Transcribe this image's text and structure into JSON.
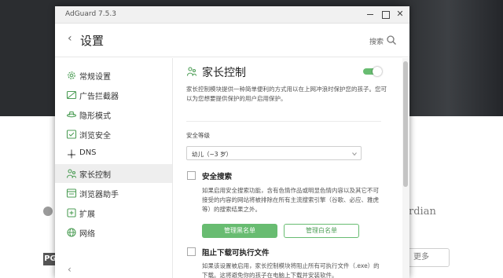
{
  "background": {
    "pg_text": "PG",
    "brand_text": "rdian",
    "more_button": "更多"
  },
  "window": {
    "title": "AdGuard 7.5.3"
  },
  "header": {
    "title": "设置",
    "search_label": "搜索"
  },
  "sidebar": {
    "items": [
      {
        "label": "常规设置",
        "icon": "gear-icon"
      },
      {
        "label": "广告拦截器",
        "icon": "ad-block-icon"
      },
      {
        "label": "隐形模式",
        "icon": "stealth-icon"
      },
      {
        "label": "浏览安全",
        "icon": "browsing-security-icon"
      },
      {
        "label": "DNS",
        "icon": "dns-icon"
      },
      {
        "label": "家长控制",
        "icon": "parental-control-icon"
      },
      {
        "label": "浏览器助手",
        "icon": "browser-assistant-icon"
      },
      {
        "label": "扩展",
        "icon": "extensions-icon"
      },
      {
        "label": "网络",
        "icon": "network-icon"
      }
    ],
    "active_index": 5
  },
  "content": {
    "title": "家长控制",
    "enabled": true,
    "description": "家长控制模块提供一种简单便利的方式用以在上网冲浪时保护您的孩子。您可以为您想要提供保护的用户启用保护。",
    "level_label": "安全等级",
    "level_value": "幼儿（~3 岁）",
    "safe_search": {
      "title": "安全搜索",
      "checked": false,
      "description": "如果启用安全搜索功能，含有色情作品或明显色情内容以及其它不可接受的内容的网站将被排除在所有主流搜索引擎（谷歌、必应、雅虎等）的搜索结果之外。"
    },
    "blacklist_button": "管理黑名单",
    "whitelist_button": "管理白名单",
    "block_exe": {
      "title": "阻止下载可执行文件",
      "checked": false,
      "description": "如果该设置被启用，家长控制模块将阻止所有可执行文件（.exe）的下载。这将避免你的孩子在电脑上下载并安装软件。"
    }
  },
  "colors": {
    "accent": "#68bc71",
    "titlebar": "#f1f1f1",
    "sidebar_active": "#eeeeee"
  }
}
